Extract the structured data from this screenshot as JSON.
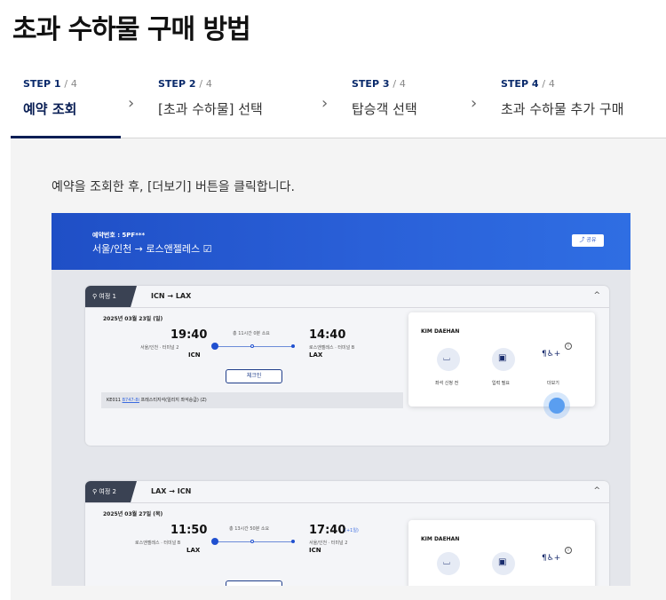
{
  "page": {
    "title": "초과 수하물 구매 방법"
  },
  "steps": [
    {
      "step": "STEP",
      "num": "1",
      "total": "4",
      "label": "예약 조회",
      "active": true
    },
    {
      "step": "STEP",
      "num": "2",
      "total": "4",
      "label": "[초과 수하물] 선택",
      "active": false
    },
    {
      "step": "STEP",
      "num": "3",
      "total": "4",
      "label": "탑승객 선택",
      "active": false
    },
    {
      "step": "STEP",
      "num": "4",
      "total": "4",
      "label": "초과 수하물 추가 구매",
      "active": false
    }
  ],
  "instruction": "예약을 조회한 후, [더보기] 버튼을 클릭합니다.",
  "screenshot": {
    "header": {
      "reservation": "예약번호 : 5PF***",
      "route": "서울/인천 → 로스앤젤레스 ☑",
      "share": "⤴ 공유"
    },
    "trips": [
      {
        "tag": "여정 1",
        "route": "ICN → LAX",
        "date": "2025년 03월 23일 (일)",
        "dep_time": "19:40",
        "dep_terminal": "서울/인천 · 터미널 2",
        "dep_code": "ICN",
        "duration": "총 11시간 0분 소요",
        "arr_time": "14:40",
        "arr_terminal": "로스앤젤레스 · 터미널 B",
        "arr_code": "LAX",
        "checkin": "체크인",
        "flight_prefix": "KE011",
        "aircraft": "B747-8i",
        "flight_suffix": "프레스티지석(일리지 좌석승급) (Z)",
        "passenger": "KIM DAEHAN",
        "options": [
          "좌석 신청 전",
          "입력 필요",
          "더보기"
        ]
      },
      {
        "tag": "여정 2",
        "route": "LAX → ICN",
        "date": "2025년 03월 27일 (목)",
        "dep_time": "11:50",
        "dep_terminal": "로스앤젤레스 · 터미널 B",
        "dep_code": "LAX",
        "duration": "총 13시간 50분 소요",
        "arr_time": "17:40",
        "arr_plus": "(+1일)",
        "arr_terminal": "서울/인천 · 터미널 2",
        "arr_code": "ICN",
        "passenger": "KIM DAEHAN"
      }
    ]
  },
  "colors": {
    "navy": "#0a1f55",
    "hero": "#2a60d8",
    "accent": "#3a6be0"
  }
}
